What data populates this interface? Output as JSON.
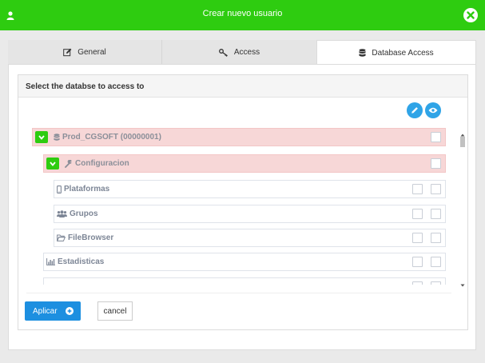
{
  "header": {
    "title": "Crear nuevo usuario",
    "user_icon": "user-icon",
    "close_icon": "close-icon"
  },
  "tabs": [
    {
      "label": "General",
      "icon": "edit-icon",
      "active": false
    },
    {
      "label": "Access",
      "icon": "key-icon",
      "active": false
    },
    {
      "label": "Database Access",
      "icon": "database-icon",
      "active": true
    }
  ],
  "panel": {
    "title": "Select the databse to access to",
    "edit_icon": "pencil-icon",
    "view_icon": "eye-icon"
  },
  "tree": [
    {
      "label": "Prod_CGSOFT (00000001)",
      "icon": "database-icon",
      "expanded": true,
      "highlight": true,
      "level": 0
    },
    {
      "label": "Configuracion",
      "icon": "wrench-icon",
      "expanded": true,
      "highlight": true,
      "level": 1
    },
    {
      "label": "Plataformas",
      "icon": "mobile-icon",
      "level": 2
    },
    {
      "label": "Grupos",
      "icon": "users-icon",
      "level": 2
    },
    {
      "label": "FileBrowser",
      "icon": "folder-icon",
      "level": 2
    },
    {
      "label": "Estadisticas",
      "icon": "bar-chart-icon",
      "level": 1
    }
  ],
  "footer": {
    "apply_label": "Aplicar",
    "cancel_label": "cancel"
  },
  "colors": {
    "header_green": "#2ecc10",
    "primary_blue": "#1d8fe0",
    "highlight_pink": "#f7d7d7"
  }
}
